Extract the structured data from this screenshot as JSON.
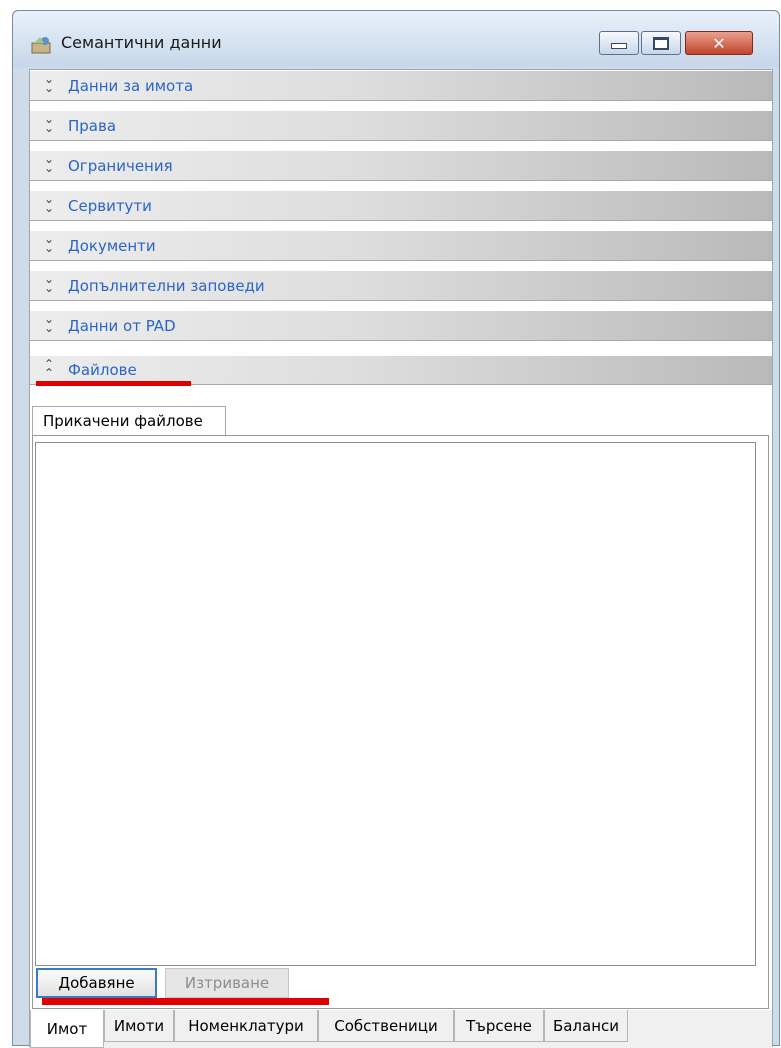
{
  "window": {
    "title": "Семантични данни",
    "minimize_icon": "minimize-icon",
    "maximize_icon": "maximize-icon",
    "close_icon": "close-icon"
  },
  "sections": [
    {
      "label": "Данни за имота",
      "expanded": false
    },
    {
      "label": "Права",
      "expanded": false
    },
    {
      "label": "Ограничения",
      "expanded": false
    },
    {
      "label": "Сервитути",
      "expanded": false
    },
    {
      "label": "Документи",
      "expanded": false
    },
    {
      "label": "Допълнителни заповеди",
      "expanded": false
    },
    {
      "label": "Данни от PAD",
      "expanded": false
    },
    {
      "label": "Файлове",
      "expanded": true
    }
  ],
  "files_panel": {
    "tab_label": "Прикачени файлове",
    "add_button": "Добавяне",
    "delete_button": "Изтриване"
  },
  "bottom_tabs": [
    "Имот",
    "Имоти",
    "Номенклатури",
    "Собственици",
    "Търсене",
    "Баланси"
  ],
  "colors": {
    "section_label": "#2a65c7",
    "highlight_underline": "#e00000",
    "focused_button_border": "#3b7bc4"
  }
}
